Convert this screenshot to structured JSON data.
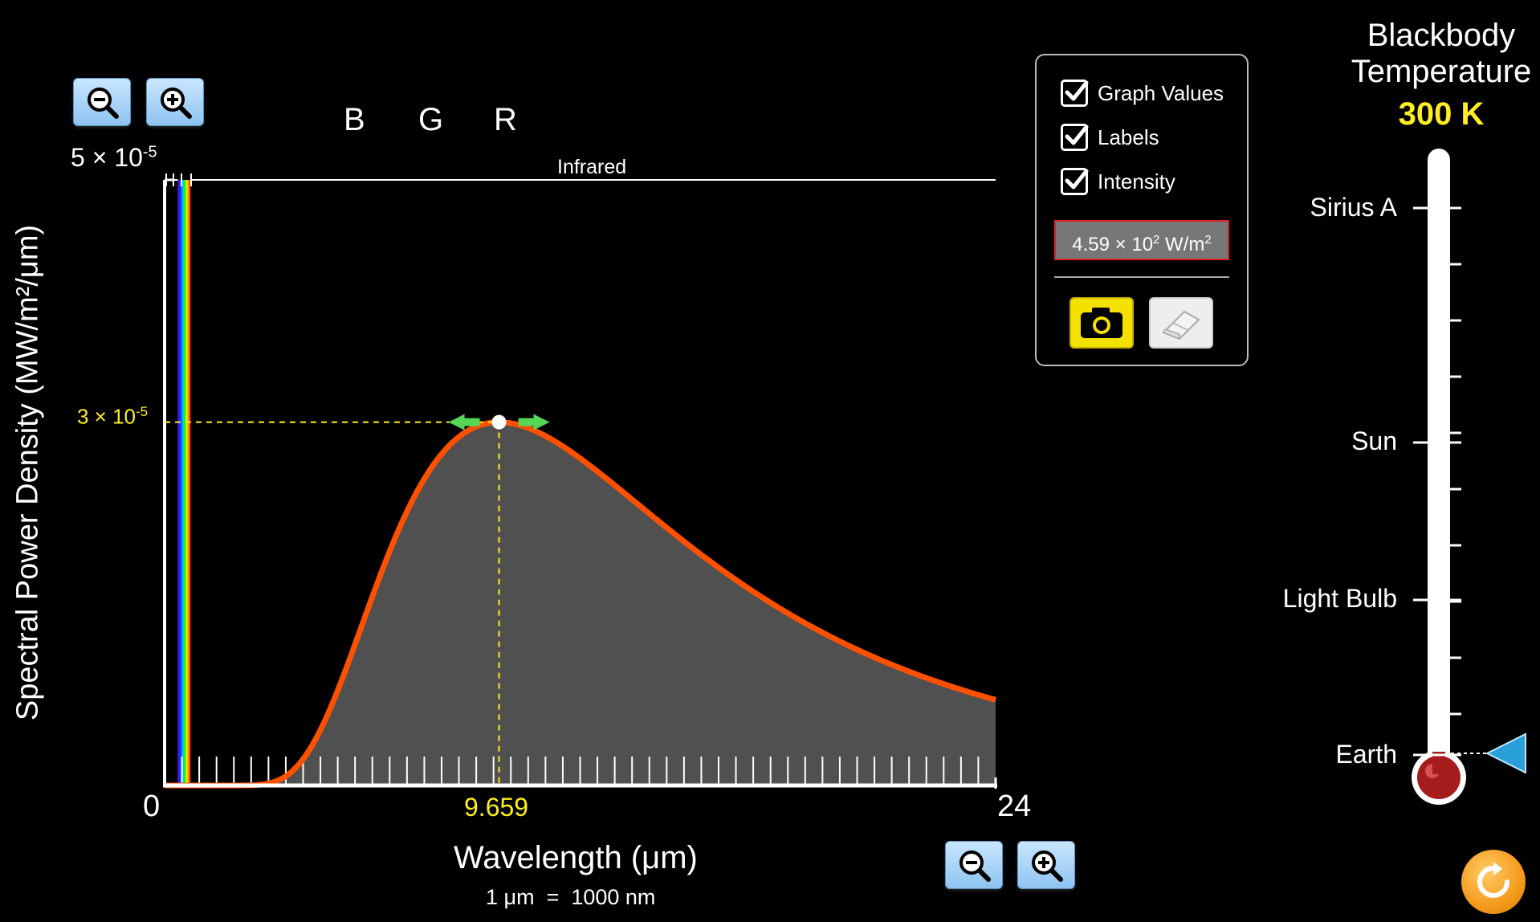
{
  "graph": {
    "y_max_label": "5 × 10",
    "y_max_exp": "-5",
    "y_peak_label": "3 × 10",
    "y_peak_exp": "-5",
    "x_min_label": "0",
    "x_max_label": "24",
    "x_peak_label": "9.659",
    "band_label": "Infrared",
    "color_letters": [
      "B",
      "G",
      "R"
    ],
    "ylabel": "Spectral Power Density (MW/m²/μm)",
    "xlabel": "Wavelength (μm)",
    "xnote": "1 μm  =  1000 nm",
    "curve_color": "#ff5000",
    "fill_color": "#505050",
    "marker_color": "#ffee22"
  },
  "chart_data": {
    "type": "area",
    "title": "",
    "xlabel": "Wavelength (μm)",
    "ylabel": "Spectral Power Density (MW/m²/μm)",
    "xlim": [
      0,
      24
    ],
    "ylim": [
      0,
      5e-05
    ],
    "temperature_K": 300,
    "peak": {
      "x": 9.659,
      "y": 3e-05
    },
    "series": [
      {
        "x": [
          0,
          2,
          3,
          4,
          5,
          6,
          7,
          8,
          9,
          9.659,
          10,
          11,
          12,
          14,
          16,
          18,
          20,
          22,
          24
        ],
        "values": [
          0,
          0,
          3e-07,
          3.8e-06,
          1.08e-05,
          1.88e-05,
          2.53e-05,
          2.91e-05,
          3.07e-05,
          3.1e-05,
          3.1e-05,
          3.02e-05,
          2.87e-05,
          2.48e-05,
          2.06e-05,
          1.71e-05,
          1.42e-05,
          1.18e-05,
          9.9e-06
        ]
      }
    ]
  },
  "options": {
    "graph_values": {
      "label": "Graph Values",
      "checked": true
    },
    "labels": {
      "label": "Labels",
      "checked": true
    },
    "intensity": {
      "label": "Intensity",
      "checked": true
    },
    "intensity_mantissa": "4.59 × 10",
    "intensity_exp": "2",
    "intensity_unit": " W/m",
    "intensity_unit_exp": "2"
  },
  "thermometer": {
    "title_line1": "Blackbody",
    "title_line2": "Temperature",
    "value": "300 K",
    "marks": [
      "Sirius A",
      "Sun",
      "Light Bulb",
      "Earth"
    ]
  },
  "icons": {
    "zoom_out": "zoom-out-icon",
    "zoom_in": "zoom-in-icon",
    "camera": "camera-icon",
    "eraser": "eraser-icon",
    "reset": "reset-icon",
    "slider": "temperature-slider-pointer"
  }
}
